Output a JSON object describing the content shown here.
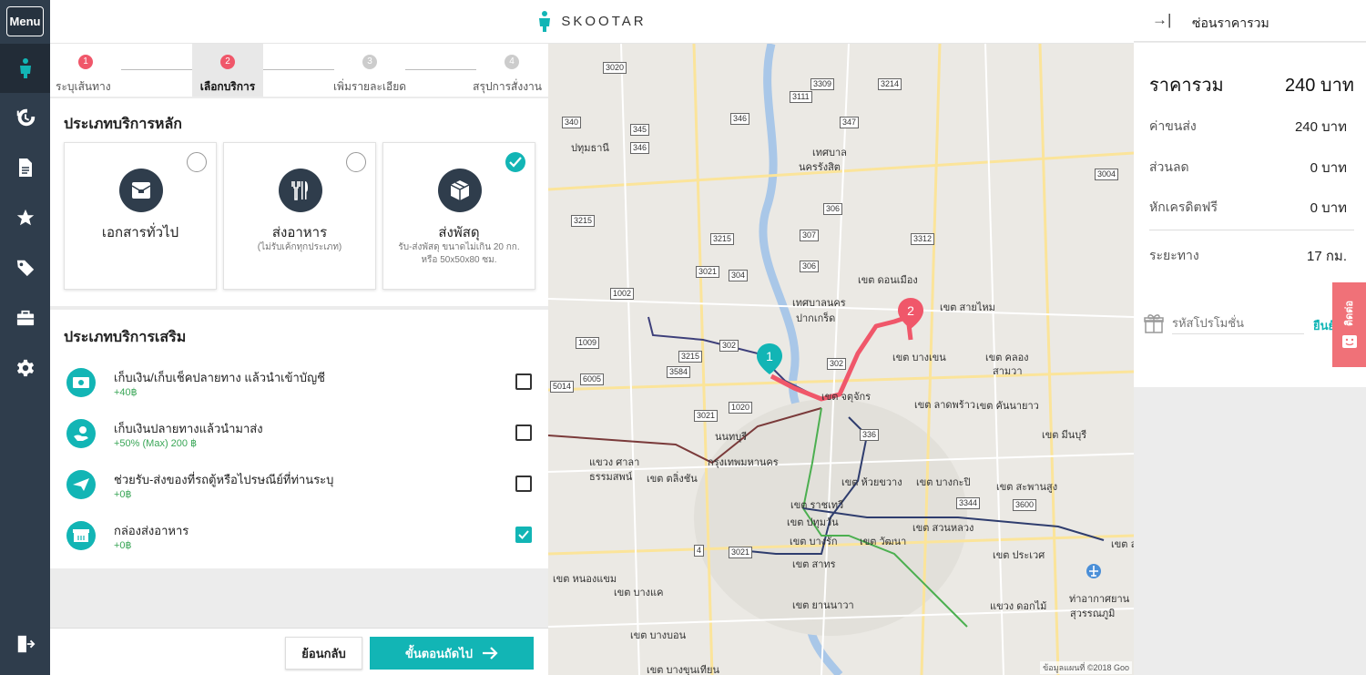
{
  "sidebar": {
    "menu_label": "Menu"
  },
  "brand": {
    "name": "SKOOTAR"
  },
  "steps": [
    {
      "num": "1",
      "label": "ระบุเส้นทาง"
    },
    {
      "num": "2",
      "label": "เลือกบริการ"
    },
    {
      "num": "3",
      "label": "เพิ่มรายละเอียด"
    },
    {
      "num": "4",
      "label": "สรุปการสั่งงาน"
    }
  ],
  "main_services": {
    "title": "ประเภทบริการหลัก",
    "items": [
      {
        "name": "เอกสารทั่วไป",
        "sub": "",
        "sub2": "",
        "selected": false
      },
      {
        "name": "ส่งอาหาร",
        "sub": "(ไม่รับเค้กทุกประเภท)",
        "sub2": "",
        "selected": false
      },
      {
        "name": "ส่งพัสดุ",
        "sub": "รับ-ส่งพัสดุ ขนาดไม่เกิน 20 กก.",
        "sub2": "หรือ 50x50x80 ซม.",
        "selected": true
      }
    ]
  },
  "extra_services": {
    "title": "ประเภทบริการเสริม",
    "items": [
      {
        "title": "เก็บเงิน/เก็บเช็คปลายทาง แล้วนำเข้าบัญชี",
        "price": "+40฿",
        "checked": false
      },
      {
        "title": "เก็บเงินปลายทางแล้วนำมาส่ง",
        "price": "+50% (Max) 200 ฿",
        "checked": false
      },
      {
        "title": "ช่วยรับ-ส่งของที่รถตู้หรือไปรษณีย์ที่ท่านระบุ",
        "price": "+0฿",
        "checked": false
      },
      {
        "title": "กล่องส่งอาหาร",
        "price": "+0฿",
        "checked": true
      }
    ]
  },
  "footer": {
    "back_label": "ย้อนกลับ",
    "next_label": "ขั้นตอนถัดไป"
  },
  "map": {
    "labels": [
      "ปทุมธานี",
      "เทศบาล",
      "นครรังสิต",
      "เทศบาลนคร",
      "ปากเกร็ด",
      "เขต ดอนเมือง",
      "เขต สายไหม",
      "เขต บางเขน",
      "เขต คลอง",
      "สามวา",
      "เขต จตุจักร",
      "เขต ลาดพร้าว",
      "เขต คันนายาว",
      "นนทบุรี",
      "กรุงเทพมหานคร",
      "เขต ตลิ่งชัน",
      "แขวง ศาลา",
      "ธรรมสพน์",
      "เขต ห้วยขวาง",
      "เขต บางกะปิ",
      "เขต สะพานสูง",
      "เขต มีนบุรี",
      "เขต ราชเทวี",
      "เขต ปทุมวัน",
      "เขต วัฒนา",
      "เขต สวนหลวง",
      "เขต ประเวศ",
      "เขต บางรัก",
      "เขต สาทร",
      "เขต บางแค",
      "เขต หนองแขม",
      "เขต ยานนาวา",
      "แขวง ดอกไม้",
      "ท่าอากาศยาน",
      "สุวรรณภูมิ",
      "เขต บางบอน",
      "เขต บางขุนเทียน",
      "เขต ลา"
    ],
    "shields": [
      "3020",
      "340",
      "346",
      "3111",
      "3309",
      "3214",
      "347",
      "346",
      "345",
      "3215",
      "3215",
      "3021",
      "304",
      "306",
      "306",
      "307",
      "3312",
      "3004",
      "302",
      "3215",
      "3584",
      "302",
      "3021",
      "336",
      "3344",
      "3600",
      "3021",
      "4",
      "1002",
      "1009",
      "6005",
      "5014",
      "1020"
    ],
    "markers": [
      "1",
      "2"
    ],
    "credit": "ข้อมูลแผนที่ ©2018 Goo"
  },
  "summary": {
    "hide_label": "ซ่อนราคารวม",
    "total_label": "ราคารวม",
    "total_value": "240 บาท",
    "rows": [
      {
        "label": "ค่าขนส่ง",
        "value": "240 บาท"
      },
      {
        "label": "ส่วนลด",
        "value": "0 บาท"
      },
      {
        "label": "หักเครดิตฟรี",
        "value": "0 บาท"
      }
    ],
    "distance_label": "ระยะทาง",
    "distance_value": "17 กม.",
    "promo_placeholder": "รหัสโปรโมชั่น",
    "promo_apply": "ยืนยัน"
  },
  "contact": {
    "label": "ติดต่อ"
  },
  "colors": {
    "accent": "#12b5b5",
    "sidebar": "#2f3d4c",
    "step_active": "#f0576a",
    "route": "#f0576a"
  }
}
